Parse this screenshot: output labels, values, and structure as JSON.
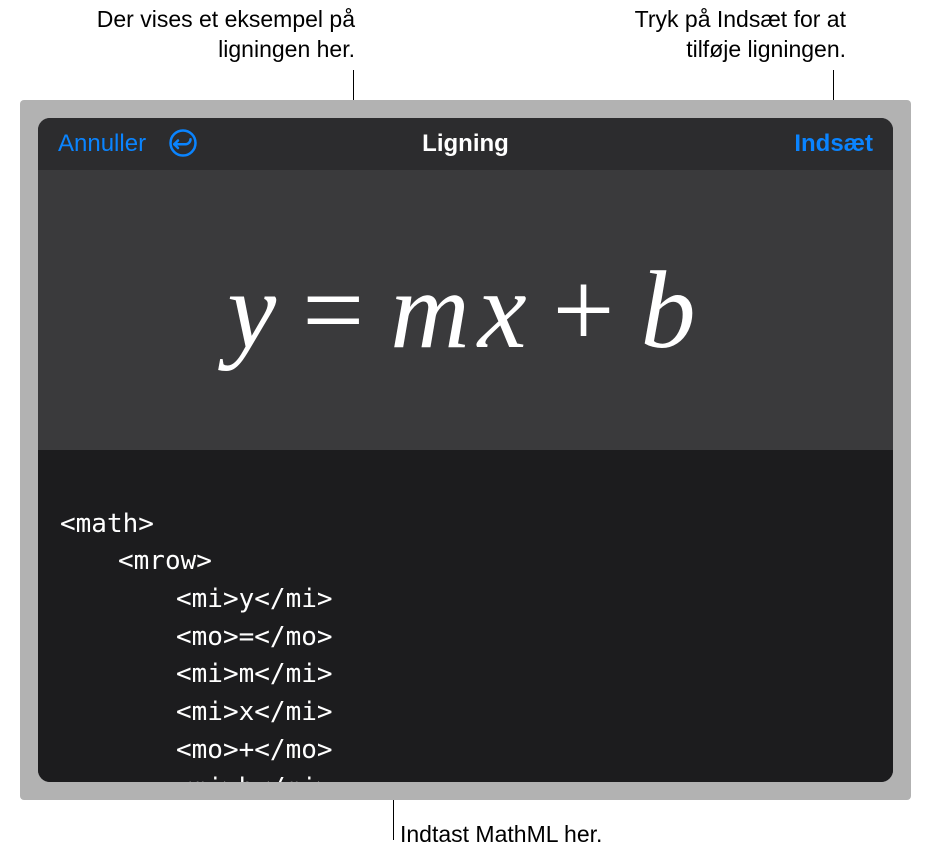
{
  "callouts": {
    "preview": "Der vises et eksempel på ligningen her.",
    "insert": "Tryk på Indsæt for at tilføje ligningen.",
    "input": "Indtast MathML her."
  },
  "header": {
    "cancel_label": "Annuller",
    "title": "Ligning",
    "insert_label": "Indsæt"
  },
  "equation": {
    "y": "y",
    "eq": "=",
    "m": "m",
    "x": "x",
    "plus": "+",
    "b": "b"
  },
  "code": {
    "l1": "<math>",
    "l2": "<mrow>",
    "l3": "<mi>y</mi>",
    "l4": "<mo>=</mo>",
    "l5": "<mi>m</mi>",
    "l6": "<mi>x</mi>",
    "l7": "<mo>+</mo>",
    "l8": "<mi>b</mi>"
  }
}
